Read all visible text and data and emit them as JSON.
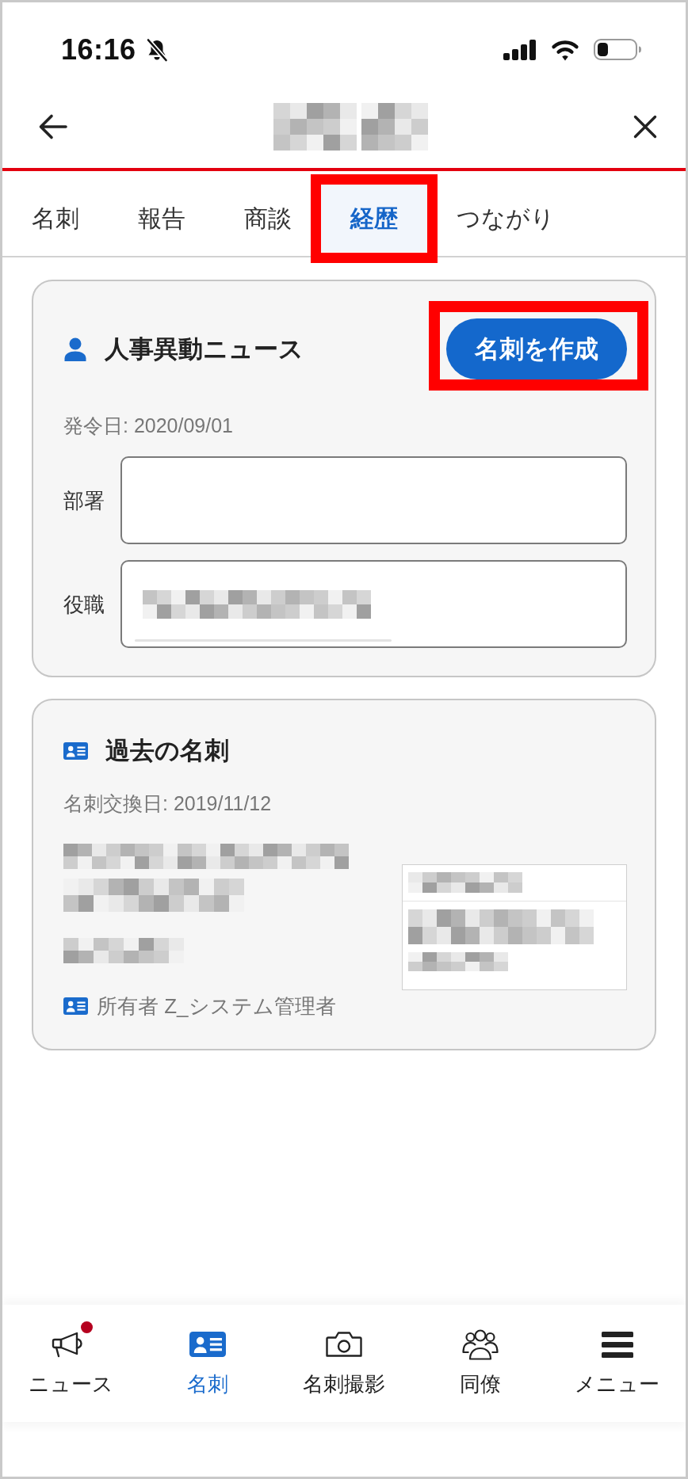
{
  "status_bar": {
    "time": "16:16",
    "silent": true
  },
  "tabs": [
    {
      "label": "名刺",
      "selected": false,
      "highlighted": false
    },
    {
      "label": "報告",
      "selected": false,
      "highlighted": false
    },
    {
      "label": "商談",
      "selected": false,
      "highlighted": false
    },
    {
      "label": "経歴",
      "selected": true,
      "highlighted": true
    },
    {
      "label": "つながり",
      "selected": false,
      "highlighted": false
    }
  ],
  "cards": [
    {
      "kind": "news",
      "title": "人事異動ニュース",
      "action": {
        "label": "名刺を作成",
        "highlighted": true
      },
      "date": "発令日: 2020/09/01",
      "fields": [
        {
          "label": "部署",
          "filled": false
        },
        {
          "label": "役職",
          "filled": true
        }
      ]
    },
    {
      "kind": "business_card",
      "title": "過去の名刺",
      "date": "名刺交換日: 2019/11/12",
      "owner": "所有者 Z_システム管理者"
    }
  ],
  "bottom_nav": [
    {
      "label": "ニュース",
      "selected": false,
      "badge": true
    },
    {
      "label": "名刺",
      "selected": true,
      "badge": false
    },
    {
      "label": "名刺撮影",
      "selected": false,
      "badge": false
    },
    {
      "label": "同僚",
      "selected": false,
      "badge": false
    },
    {
      "label": "メニュー",
      "selected": false,
      "badge": false
    }
  ]
}
